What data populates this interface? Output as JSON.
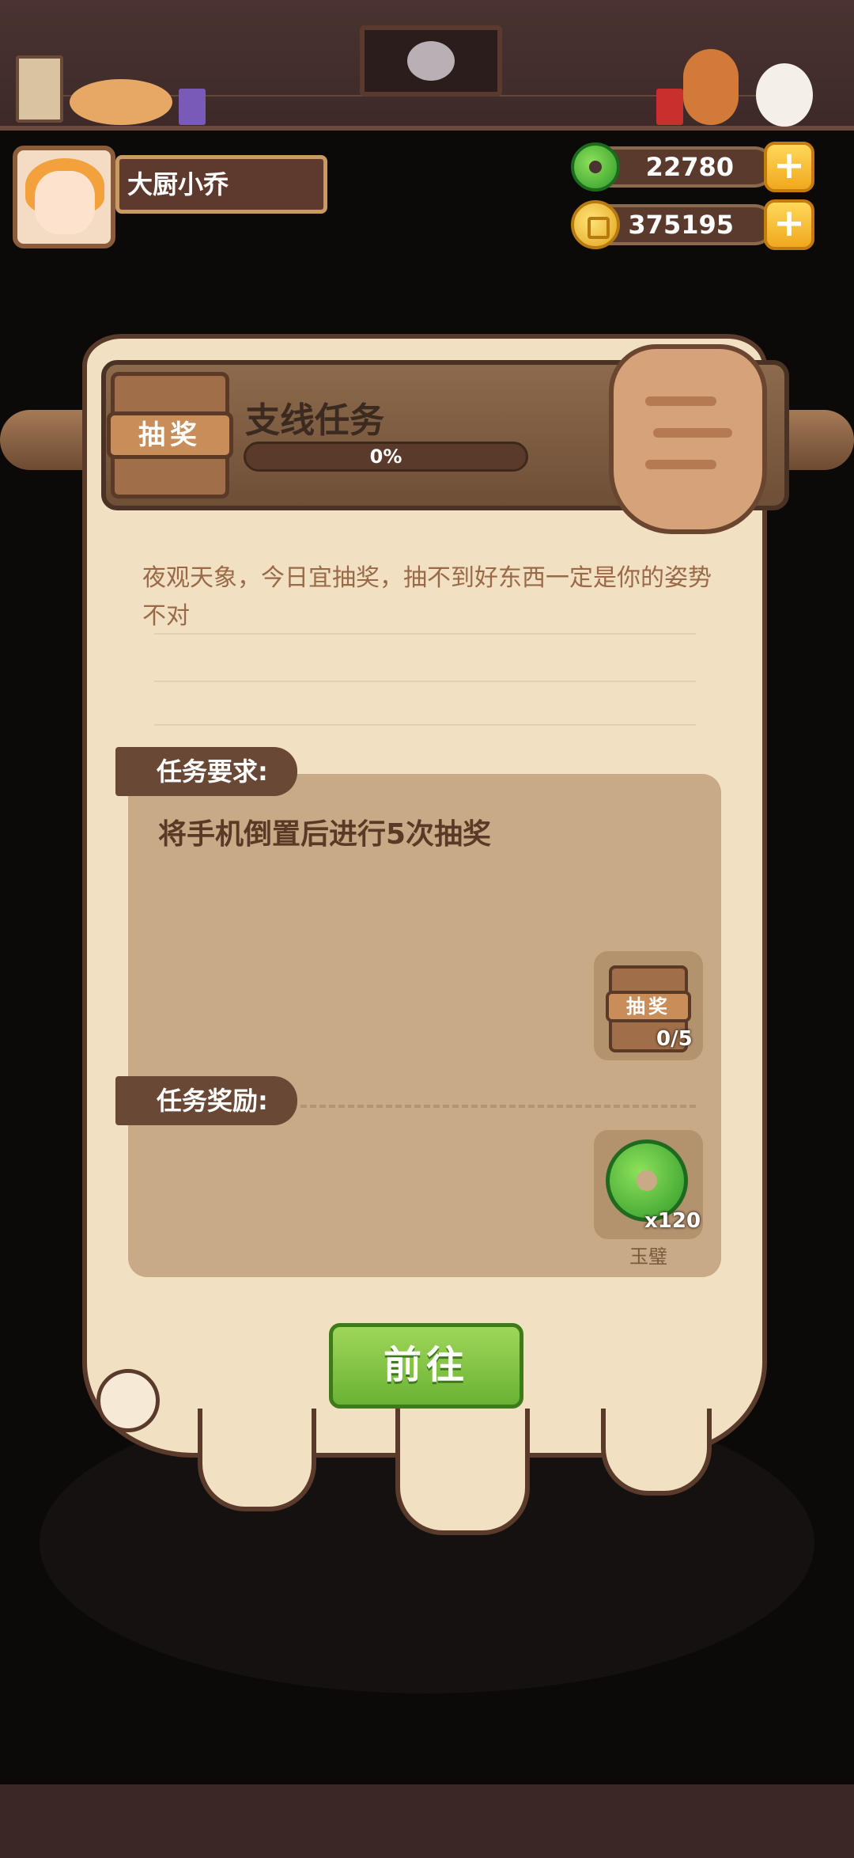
{
  "player": {
    "name": "大厨小乔"
  },
  "currency": {
    "jade": {
      "value": "22780",
      "icon": "jade-disc-icon"
    },
    "coin": {
      "value": "375195",
      "icon": "gold-coin-icon"
    },
    "add_label": "+"
  },
  "dialog": {
    "badge_label": "抽奖",
    "title": "支线任务",
    "progress_text": "0%",
    "progress": 0,
    "description": "夜观天象，今日宜抽奖，抽不到好东西一定是你的姿势不对",
    "requirement_tab": "任务要求:",
    "requirement_text": "将手机倒置后进行5次抽奖",
    "requirement_item": {
      "label": "抽奖",
      "count": "0/5"
    },
    "reward_tab": "任务奖励:",
    "reward_item": {
      "count": "x120",
      "name": "玉璧"
    },
    "go_button": "前往"
  },
  "colors": {
    "accent_green": "#6ab234",
    "scroll_bg": "#f1e0c2",
    "panel_brown": "#6e4f37",
    "gold": "#f0a81e"
  }
}
